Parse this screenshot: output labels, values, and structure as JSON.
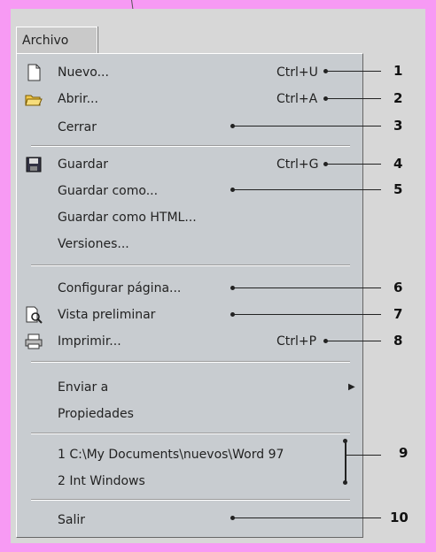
{
  "menu_title": "Archivo",
  "items": {
    "nuevo": {
      "label": "Nuevo...",
      "shortcut": "Ctrl+U"
    },
    "abrir": {
      "label": "Abrir...",
      "shortcut": "Ctrl+A"
    },
    "cerrar": {
      "label": "Cerrar"
    },
    "guardar": {
      "label": "Guardar",
      "shortcut": "Ctrl+G"
    },
    "guardar_como": {
      "label": "Guardar como..."
    },
    "guardar_html": {
      "label": "Guardar como HTML..."
    },
    "versiones": {
      "label": "Versiones..."
    },
    "configurar": {
      "label": "Configurar página..."
    },
    "vista": {
      "label": "Vista preliminar"
    },
    "imprimir": {
      "label": "Imprimir...",
      "shortcut": "Ctrl+P"
    },
    "enviar": {
      "label": "Enviar a"
    },
    "propiedades": {
      "label": "Propiedades"
    },
    "recent1": {
      "label": "1 C:\\My Documents\\nuevos\\Word 97"
    },
    "recent2": {
      "label": "2 Int  Windows"
    },
    "salir": {
      "label": "Salir"
    }
  },
  "callouts": [
    "1",
    "2",
    "3",
    "4",
    "5",
    "6",
    "7",
    "8",
    "9",
    "10"
  ],
  "colors": {
    "background": "#f79af4",
    "menu": "#c8ccd0"
  }
}
